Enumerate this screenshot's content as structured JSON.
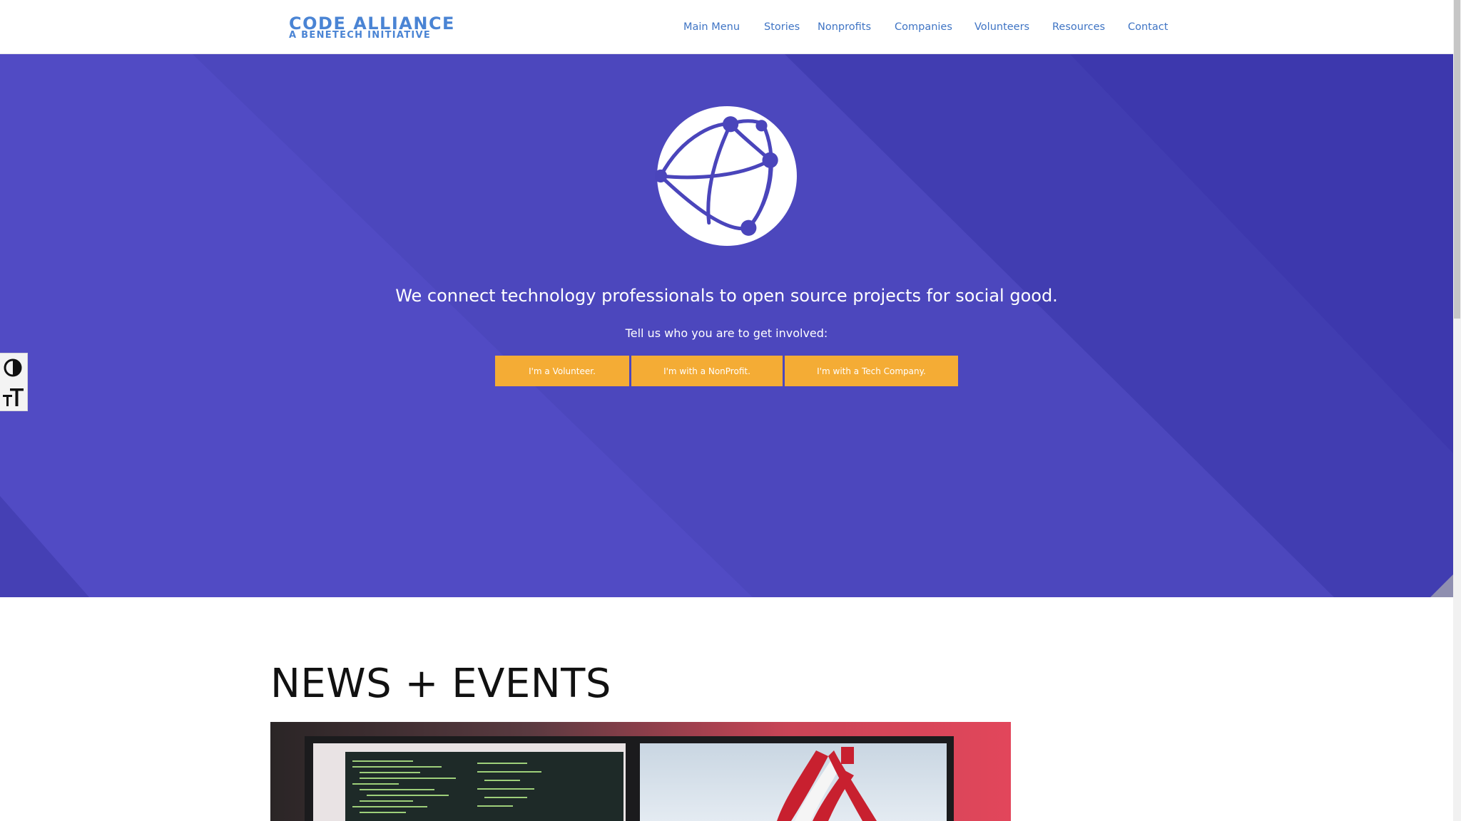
{
  "header": {
    "logo_line1": "CODE ALLIANCE",
    "logo_line2": "A BENETECH INITIATIVE",
    "nav": [
      "Main Menu",
      "Stories",
      "Nonprofits",
      "Companies",
      "Volunteers",
      "Resources",
      "Contact"
    ]
  },
  "hero": {
    "tagline": "We connect technology professionals to open source projects for social good.",
    "subtagline": "Tell us who you are to get involved:",
    "buttons": {
      "volunteer": "I'm a Volunteer.",
      "nonprofit": "I'm with a NonProfit.",
      "company": "I'm with a Tech Company."
    }
  },
  "news": {
    "title": "NEWS + EVENTS"
  },
  "colors": {
    "brand_blue": "#4a84d4",
    "nav_blue": "#3f74c4",
    "hero_purple": "#4a45bb",
    "cta_orange": "#f4ac35"
  },
  "icons": {
    "globe": "globe-network-icon",
    "contrast": "contrast-toggle-icon",
    "font_size": "font-size-icon"
  }
}
